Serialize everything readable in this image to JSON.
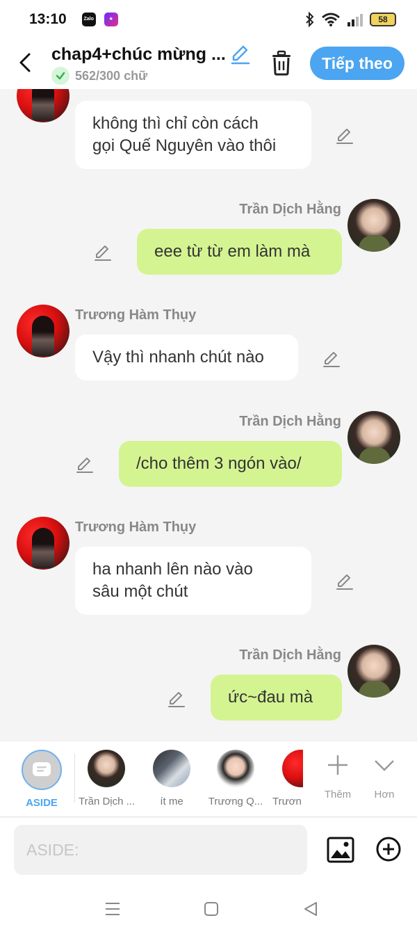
{
  "status_bar": {
    "time": "13:10",
    "battery": "58",
    "app_icons": [
      "zalo-icon",
      "star-app-icon"
    ]
  },
  "header": {
    "title": "chap4+chúc mừng ...",
    "word_count": "562/300 chữ",
    "next_label": "Tiếp theo"
  },
  "messages": [
    {
      "side": "left",
      "name": "",
      "text_lines": [
        "không thì chỉ còn cách",
        "gọi Quế Nguyên vào thôi"
      ]
    },
    {
      "side": "right",
      "name": "Trần Dịch Hằng",
      "text_lines": [
        "eee từ từ em làm mà"
      ]
    },
    {
      "side": "left",
      "name": "Trương Hàm Thụy",
      "text_lines": [
        "Vậy thì nhanh chút nào"
      ]
    },
    {
      "side": "right",
      "name": "Trần Dịch Hằng",
      "text_lines": [
        "/cho thêm 3 ngón vào/"
      ]
    },
    {
      "side": "left",
      "name": "Trương Hàm Thụy",
      "text_lines": [
        "ha nhanh lên nào vào",
        "sâu một chút"
      ]
    },
    {
      "side": "right",
      "name": "Trần Dịch Hằng",
      "text_lines": [
        "ức~đau mà"
      ]
    }
  ],
  "characters": {
    "aside_label": "ASIDE",
    "items": [
      {
        "label": "Trần Dịch ..."
      },
      {
        "label": "ít me"
      },
      {
        "label": "Trương Q..."
      },
      {
        "label": "Trươn"
      }
    ],
    "more_label": "Thêm",
    "collapse_label": "Hơn"
  },
  "input": {
    "placeholder": "ASIDE:"
  },
  "colors": {
    "accent": "#4ba5f0",
    "right_bubble": "#d4f492",
    "left_bubble": "#ffffff",
    "background": "#f4f4f4"
  }
}
